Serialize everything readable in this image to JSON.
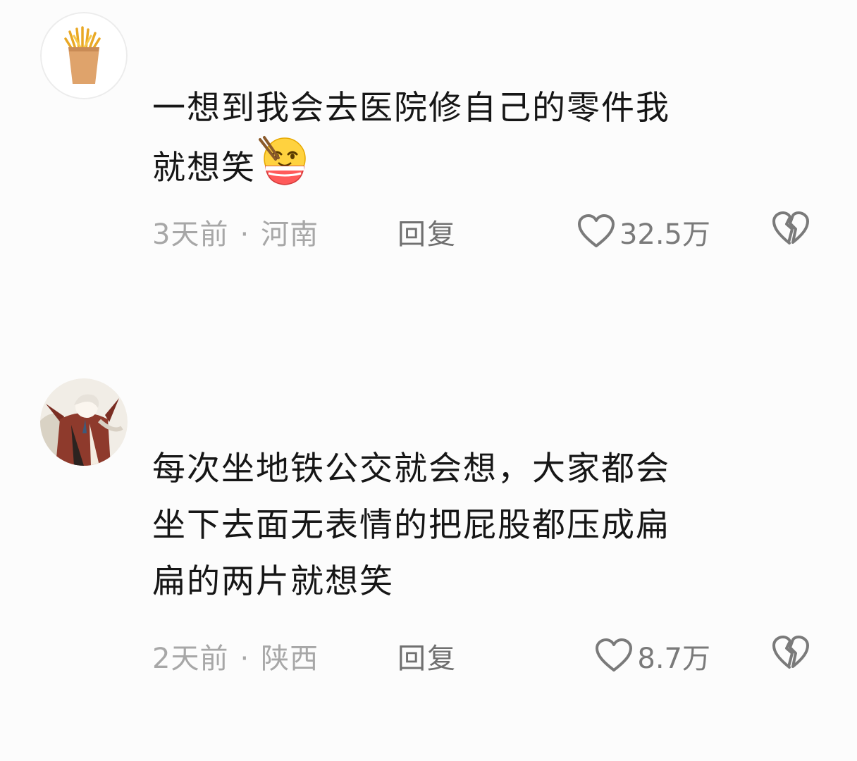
{
  "comments": [
    {
      "avatar_icon": "fries-icon",
      "text_lines": [
        "一想到我会去医院修自己的零件我",
        "就想笑"
      ],
      "emoji_icon": "hungry-face-emoji",
      "time": "3天前",
      "separator": "·",
      "location": "河南",
      "reply_label": "回复",
      "like_count": "32.5万"
    },
    {
      "avatar_icon": "anime-character-avatar",
      "text_lines": [
        "每次坐地铁公交就会想，大家都会",
        "坐下去面无表情的把屁股都压成扁",
        "扁的两片就想笑"
      ],
      "time": "2天前",
      "separator": "·",
      "location": "陕西",
      "reply_label": "回复",
      "like_count": "8.7万"
    }
  ],
  "icons": {
    "like": "heart-outline-icon",
    "dislike": "broken-heart-icon"
  },
  "colors": {
    "background": "#fcfcfc",
    "text": "#161616",
    "meta": "#a7a7a7",
    "reply": "#707070",
    "icon": "#7a7a7a"
  }
}
